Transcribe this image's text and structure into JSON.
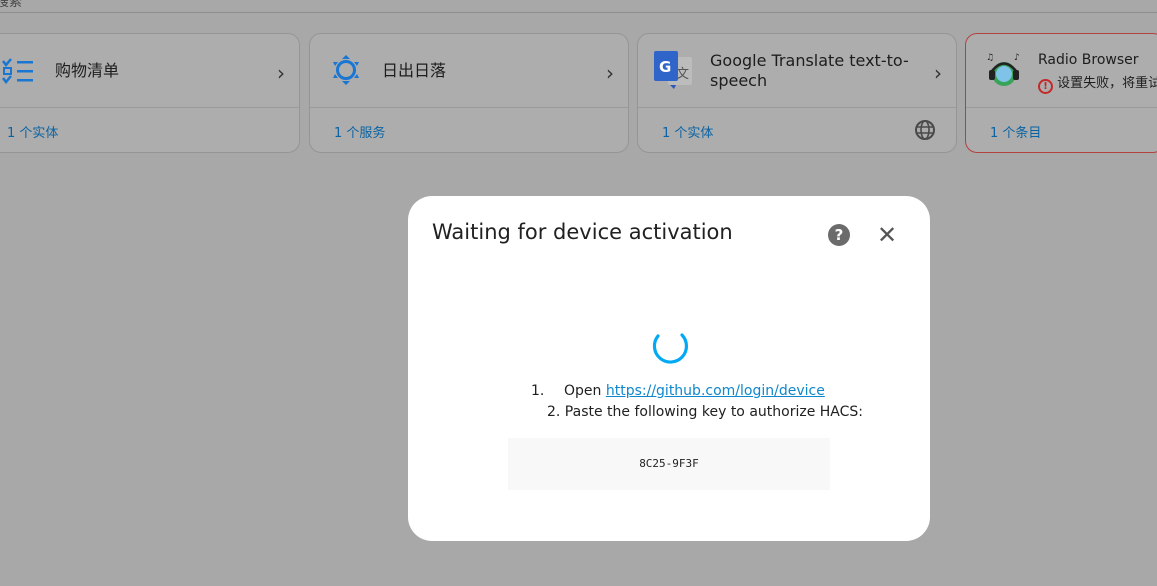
{
  "top_fragment": "搜索",
  "cards": [
    {
      "title": "购物清单",
      "footer": "1 个实体"
    },
    {
      "title": "日出日落",
      "footer": "1 个服务"
    },
    {
      "title": "Google Translate text-to-speech",
      "footer": "1 个实体"
    },
    {
      "title": "Radio Browser",
      "error": "设置失败，将重试",
      "footer": "1 个条目"
    }
  ],
  "dialog": {
    "title": "Waiting for device activation",
    "step1_number": "1.",
    "step1_text": "Open",
    "step1_link": "https://github.com/login/device",
    "step2_text": "2. Paste the following key to authorize HACS:",
    "code": "8C25-9F3F"
  },
  "colors": {
    "overlay": "#a8a8a8",
    "link": "#0e87cc",
    "spinner": "#03a9f4",
    "error": "#db4437"
  }
}
